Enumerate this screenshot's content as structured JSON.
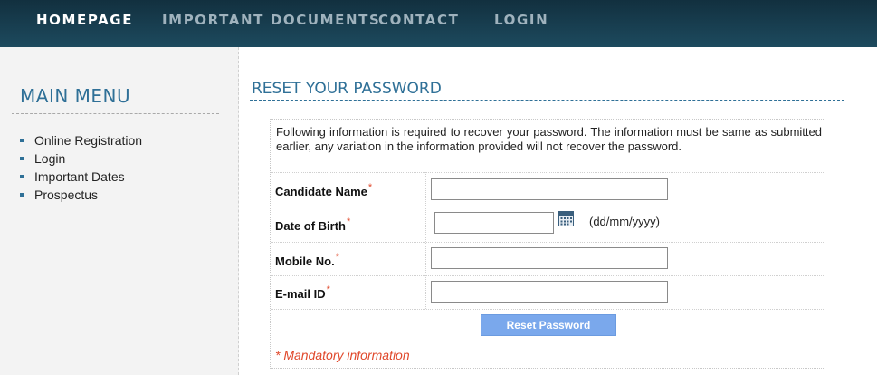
{
  "nav": {
    "items": [
      "HOMEPAGE",
      "IMPORTANT DOCUMENTS",
      "CONTACT",
      "LOGIN"
    ]
  },
  "sidebar": {
    "title": "MAIN MENU",
    "items": [
      "Online Registration",
      "Login",
      "Important Dates",
      "Prospectus"
    ]
  },
  "page": {
    "title": "RESET YOUR PASSWORD"
  },
  "form": {
    "info": "Following information is required to recover your password. The information must be same as submitted earlier, any variation in the information provided will not recover the password.",
    "required_mark": "*",
    "fields": {
      "candidate_name": {
        "label": "Candidate Name",
        "value": ""
      },
      "dob": {
        "label": "Date of Birth",
        "value": "",
        "hint": "(dd/mm/yyyy)"
      },
      "mobile": {
        "label": "Mobile No.",
        "value": ""
      },
      "email": {
        "label": "E-mail ID",
        "value": ""
      }
    },
    "submit_label": "Reset Password",
    "mandatory_note": "* Mandatory information"
  },
  "colors": {
    "accent": "#2f7097",
    "required": "#e0482b",
    "button": "#7aa8ec",
    "nav_bg": "#173d4f"
  },
  "icons": {
    "calendar": "calendar-icon"
  }
}
